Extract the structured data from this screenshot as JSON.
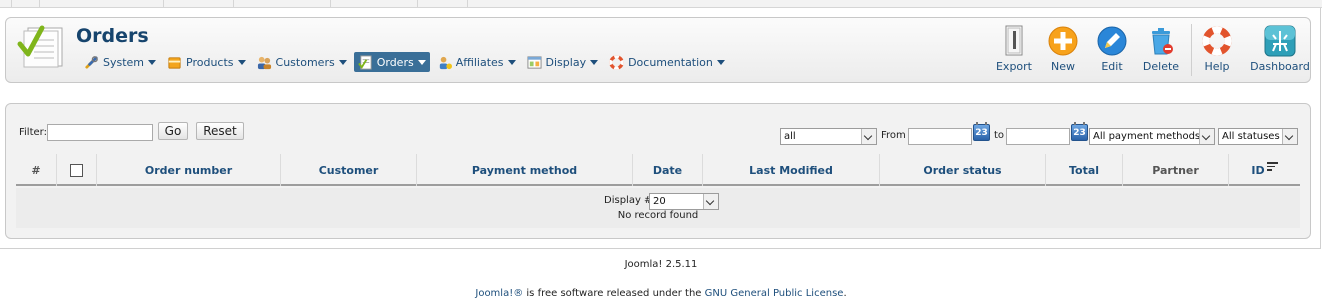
{
  "page": {
    "title": "Orders",
    "icon": "orders-checklist-icon"
  },
  "menu": [
    {
      "label": "System",
      "icon": "wrench-icon",
      "active": false
    },
    {
      "label": "Products",
      "icon": "box-icon",
      "active": false
    },
    {
      "label": "Customers",
      "icon": "users-icon",
      "active": false
    },
    {
      "label": "Orders",
      "icon": "order-form-icon",
      "active": true
    },
    {
      "label": "Affiliates",
      "icon": "affiliate-icon",
      "active": false
    },
    {
      "label": "Display",
      "icon": "display-window-icon",
      "active": false
    },
    {
      "label": "Documentation",
      "icon": "lifebuoy-icon",
      "active": false
    }
  ],
  "toolbar": {
    "export": "Export",
    "new": "New",
    "edit": "Edit",
    "delete": "Delete",
    "help": "Help",
    "dashboard": "Dashboard"
  },
  "filters": {
    "filter_label": "Filter:",
    "filter_value": "",
    "go": "Go",
    "reset": "Reset",
    "type_select": "all",
    "from_label": "From",
    "to_label": "to",
    "calendar_label": "23",
    "payment_select": "All payment methods",
    "status_select": "All statuses"
  },
  "table": {
    "columns": [
      "#",
      "",
      "Order number",
      "Customer",
      "Payment method",
      "Date",
      "Last Modified",
      "Order status",
      "Total",
      "Partner",
      "ID"
    ]
  },
  "pagination": {
    "display_label": "Display #",
    "display_value": "20",
    "empty_message": "No record found"
  },
  "footer": {
    "version": "Joomla! 2.5.11",
    "license_prefix": "Joomla!®",
    "license_middle": " is free software released under the ",
    "license_link": "GNU General Public License",
    "license_suffix": "."
  },
  "colors": {
    "title": "#16446d",
    "link": "#1e4f7c",
    "active_menu": "#3a6f98"
  }
}
